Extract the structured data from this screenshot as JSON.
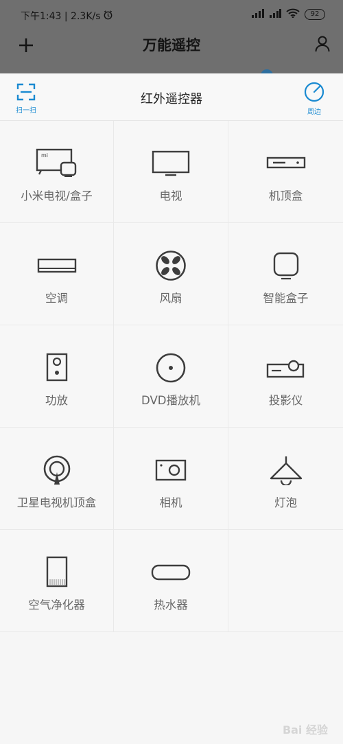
{
  "status_bar": {
    "time_and_speed": "下午1:43 | 2.3K/s",
    "battery": "92"
  },
  "app_header": {
    "title": "万能遥控"
  },
  "sheet": {
    "title": "红外遥控器",
    "scan_label": "扫一扫",
    "nearby_label": "周边"
  },
  "devices": [
    {
      "label": "小米电视/盒子",
      "icon": "mi-tv-box-icon"
    },
    {
      "label": "电视",
      "icon": "tv-icon"
    },
    {
      "label": "机顶盒",
      "icon": "set-top-box-icon"
    },
    {
      "label": "空调",
      "icon": "air-conditioner-icon"
    },
    {
      "label": "风扇",
      "icon": "fan-icon"
    },
    {
      "label": "智能盒子",
      "icon": "smart-box-icon"
    },
    {
      "label": "功放",
      "icon": "amplifier-icon"
    },
    {
      "label": "DVD播放机",
      "icon": "dvd-player-icon"
    },
    {
      "label": "投影仪",
      "icon": "projector-icon"
    },
    {
      "label": "卫星电视机顶盒",
      "icon": "satellite-box-icon"
    },
    {
      "label": "相机",
      "icon": "camera-icon"
    },
    {
      "label": "灯泡",
      "icon": "lamp-icon"
    },
    {
      "label": "空气净化器",
      "icon": "air-purifier-icon"
    },
    {
      "label": "热水器",
      "icon": "water-heater-icon"
    }
  ],
  "watermark": "Bai 经验",
  "colors": {
    "accent": "#1a8ad1",
    "icon_stroke": "#3d3d3d",
    "label_text": "#666666",
    "overlay": "#6f6f6f"
  }
}
